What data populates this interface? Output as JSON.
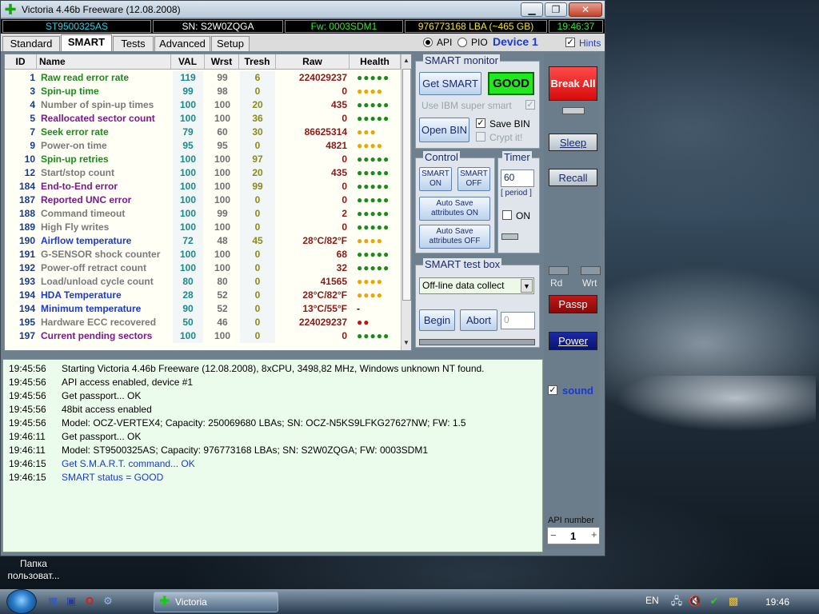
{
  "window": {
    "title": "Victoria 4.46b Freeware (12.08.2008)",
    "min_glyph": "▁",
    "max_glyph": "❐",
    "close_glyph": "✕"
  },
  "infobar": {
    "model": "ST9500325AS",
    "serial": "SN: S2W0ZQGA",
    "firmware": "Fw: 0003SDM1",
    "capacity": "976773168 LBA (~465 GB)",
    "clock": "19:46:37"
  },
  "tabs": [
    "Standard",
    "SMART",
    "Tests",
    "Advanced",
    "Setup"
  ],
  "mode": {
    "api": "API",
    "pio": "PIO",
    "device": "Device 1",
    "hints": "Hints"
  },
  "smart_table": {
    "headers": {
      "id": "ID",
      "name": "Name",
      "val": "VAL",
      "wrst": "Wrst",
      "tresh": "Tresh",
      "raw": "Raw",
      "health": "Health"
    },
    "rows": [
      {
        "id": "1",
        "name": "Raw read error rate",
        "val": "119",
        "wrst": "99",
        "tresh": "6",
        "raw": "224029237",
        "health": "●●●●●",
        "name_color": "#1d8a1d",
        "health_color": "#1d8a1d"
      },
      {
        "id": "3",
        "name": "Spin-up time",
        "val": "99",
        "wrst": "98",
        "tresh": "0",
        "raw": "0",
        "health": "●●●●",
        "name_color": "#1d8a1d",
        "health_color": "#e8a800"
      },
      {
        "id": "4",
        "name": "Number of spin-up times",
        "val": "100",
        "wrst": "100",
        "tresh": "20",
        "raw": "435",
        "health": "●●●●●",
        "name_color": "#7a7a7a",
        "health_color": "#1d8a1d"
      },
      {
        "id": "5",
        "name": "Reallocated sector count",
        "val": "100",
        "wrst": "100",
        "tresh": "36",
        "raw": "0",
        "health": "●●●●●",
        "name_color": "#7a1a8a",
        "health_color": "#1d8a1d"
      },
      {
        "id": "7",
        "name": "Seek error rate",
        "val": "79",
        "wrst": "60",
        "tresh": "30",
        "raw": "86625314",
        "health": "●●●",
        "name_color": "#1d8a1d",
        "health_color": "#e8a800"
      },
      {
        "id": "9",
        "name": "Power-on time",
        "val": "95",
        "wrst": "95",
        "tresh": "0",
        "raw": "4821",
        "health": "●●●●",
        "name_color": "#7a7a7a",
        "health_color": "#e8a800"
      },
      {
        "id": "10",
        "name": "Spin-up retries",
        "val": "100",
        "wrst": "100",
        "tresh": "97",
        "raw": "0",
        "health": "●●●●●",
        "name_color": "#1d8a1d",
        "health_color": "#1d8a1d"
      },
      {
        "id": "12",
        "name": "Start/stop count",
        "val": "100",
        "wrst": "100",
        "tresh": "20",
        "raw": "435",
        "health": "●●●●●",
        "name_color": "#7a7a7a",
        "health_color": "#1d8a1d"
      },
      {
        "id": "184",
        "name": "End-to-End error",
        "val": "100",
        "wrst": "100",
        "tresh": "99",
        "raw": "0",
        "health": "●●●●●",
        "name_color": "#7a1a8a",
        "health_color": "#1d8a1d"
      },
      {
        "id": "187",
        "name": "Reported UNC error",
        "val": "100",
        "wrst": "100",
        "tresh": "0",
        "raw": "0",
        "health": "●●●●●",
        "name_color": "#7a1a8a",
        "health_color": "#1d8a1d"
      },
      {
        "id": "188",
        "name": "Command timeout",
        "val": "100",
        "wrst": "99",
        "tresh": "0",
        "raw": "2",
        "health": "●●●●●",
        "name_color": "#7a7a7a",
        "health_color": "#1d8a1d"
      },
      {
        "id": "189",
        "name": "High Fly writes",
        "val": "100",
        "wrst": "100",
        "tresh": "0",
        "raw": "0",
        "health": "●●●●●",
        "name_color": "#7a7a7a",
        "health_color": "#1d8a1d"
      },
      {
        "id": "190",
        "name": "Airflow temperature",
        "val": "72",
        "wrst": "48",
        "tresh": "45",
        "raw": "28°C/82°F",
        "health": "●●●●",
        "name_color": "#1a3acb",
        "health_color": "#e8a800"
      },
      {
        "id": "191",
        "name": "G-SENSOR shock counter",
        "val": "100",
        "wrst": "100",
        "tresh": "0",
        "raw": "68",
        "health": "●●●●●",
        "name_color": "#7a7a7a",
        "health_color": "#1d8a1d"
      },
      {
        "id": "192",
        "name": "Power-off retract count",
        "val": "100",
        "wrst": "100",
        "tresh": "0",
        "raw": "32",
        "health": "●●●●●",
        "name_color": "#7a7a7a",
        "health_color": "#1d8a1d"
      },
      {
        "id": "193",
        "name": "Load/unload cycle count",
        "val": "80",
        "wrst": "80",
        "tresh": "0",
        "raw": "41565",
        "health": "●●●●",
        "name_color": "#7a7a7a",
        "health_color": "#e8a800"
      },
      {
        "id": "194",
        "name": "HDA Temperature",
        "val": "28",
        "wrst": "52",
        "tresh": "0",
        "raw": "28°C/82°F",
        "health": "●●●●",
        "name_color": "#1a3acb",
        "health_color": "#e8a800"
      },
      {
        "id": "194",
        "name": "Minimum temperature",
        "val": "90",
        "wrst": "52",
        "tresh": "0",
        "raw": "13°C/55°F",
        "health": "-",
        "name_color": "#1a3acb",
        "health_color": "#000000"
      },
      {
        "id": "195",
        "name": "Hardware ECC recovered",
        "val": "50",
        "wrst": "46",
        "tresh": "0",
        "raw": "224029237",
        "health": "●●",
        "name_color": "#7a7a7a",
        "health_color": "#d01010"
      },
      {
        "id": "197",
        "name": "Current pending sectors",
        "val": "100",
        "wrst": "100",
        "tresh": "0",
        "raw": "0",
        "health": "●●●●●",
        "name_color": "#7a1a8a",
        "health_color": "#1d8a1d"
      }
    ]
  },
  "smart_monitor": {
    "title": "SMART monitor",
    "get_smart": "Get SMART",
    "status": "GOOD",
    "ibm_label": "Use IBM super smart",
    "open_bin": "Open BIN",
    "save_bin": "Save BIN",
    "crypt": "Crypt it!"
  },
  "control": {
    "title": "Control",
    "smart_on": "SMART ON",
    "smart_off": "SMART OFF",
    "autosave_on": "Auto Save attributes ON",
    "autosave_off": "Auto Save attributes OFF"
  },
  "timer": {
    "title": "Timer",
    "value": "60",
    "period": "[ period ]",
    "on": "ON"
  },
  "test_box": {
    "title": "SMART test box",
    "selected": "Off-line data collect",
    "begin": "Begin",
    "abort": "Abort",
    "value": "0"
  },
  "right_column": {
    "break_all": "Break All",
    "sleep": "Sleep",
    "recall": "Recall",
    "rd": "Rd",
    "wrt": "Wrt",
    "passp": "Passp",
    "power": "Power",
    "sound": "sound",
    "api_number_label": "API number",
    "api_number": "1",
    "minus": "−",
    "plus": "+"
  },
  "log": [
    {
      "time": "19:45:56",
      "msg": "Starting Victoria 4.46b Freeware (12.08.2008), 8xCPU, 3498,82 MHz, Windows unknown NT found.",
      "color": "#000000"
    },
    {
      "time": "19:45:56",
      "msg": "API access enabled, device #1",
      "color": "#000000"
    },
    {
      "time": "19:45:56",
      "msg": "Get passport... OK",
      "color": "#000000"
    },
    {
      "time": "19:45:56",
      "msg": "48bit access enabled",
      "color": "#000000"
    },
    {
      "time": "19:45:56",
      "msg": "Model: OCZ-VERTEX4; Capacity: 250069680 LBAs; SN: OCZ-N5KS9LFKG27627NW; FW: 1.5",
      "color": "#000000"
    },
    {
      "time": "19:46:11",
      "msg": "Get passport... OK",
      "color": "#000000"
    },
    {
      "time": "19:46:11",
      "msg": "Model: ST9500325AS; Capacity: 976773168 LBAs; SN: S2W0ZQGA; FW: 0003SDM1",
      "color": "#000000"
    },
    {
      "time": "19:46:15",
      "msg": "Get S.M.A.R.T. command... OK",
      "color": "#1a3acb"
    },
    {
      "time": "19:46:15",
      "msg": "SMART status = GOOD",
      "color": "#1a3acb"
    }
  ],
  "desktop": {
    "folder_label": "Папка пользоват..."
  },
  "taskbar": {
    "task": "Victoria",
    "lang": "EN",
    "clock": "19:46"
  }
}
